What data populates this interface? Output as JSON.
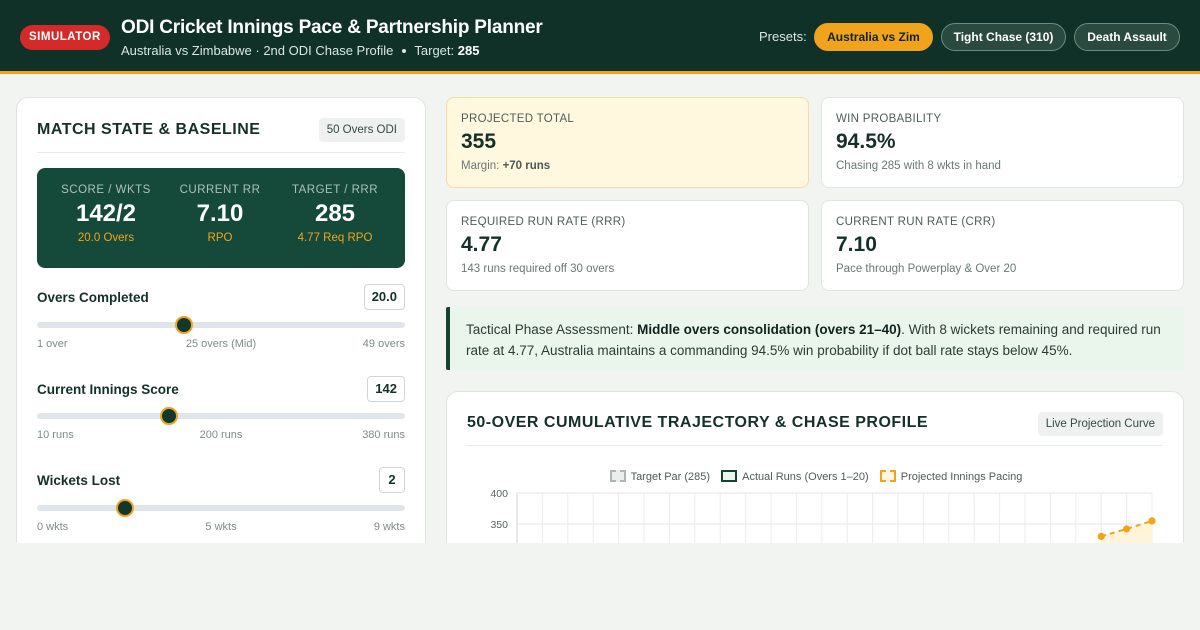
{
  "header": {
    "badge": "SIMULATOR",
    "title": "ODI Cricket Innings Pace & Partnership Planner",
    "subtitle": "Australia vs Zimbabwe · 2nd ODI Chase Profile",
    "target_label": "Target:",
    "target_value": "285",
    "presets_label": "Presets:",
    "presets": [
      "Australia vs Zim",
      "Tight Chase (310)",
      "Death Assault"
    ],
    "accent": "#f0a31b",
    "brand": "#0f3128"
  },
  "left": {
    "title": "MATCH STATE & BASELINE",
    "tag": "50 Overs ODI",
    "scoreboard": [
      {
        "label": "SCORE / WKTS",
        "value": "142/2",
        "foot": "20.0 Overs"
      },
      {
        "label": "CURRENT RR",
        "value": "7.10",
        "foot": "RPO"
      },
      {
        "label": "TARGET / RRR",
        "value": "285",
        "foot": "4.77 Req RPO"
      }
    ],
    "sliders": {
      "overs": {
        "label": "Overs Completed",
        "value": "20.0",
        "fraction": 0.4,
        "ticks": [
          "1 over",
          "25 overs (Mid)",
          "49 overs"
        ]
      },
      "score": {
        "label": "Current Innings Score",
        "value": "142",
        "fraction": 0.36,
        "ticks": [
          "10 runs",
          "200 runs",
          "380 runs"
        ]
      },
      "wickets": {
        "label": "Wickets Lost",
        "value": "2",
        "fraction": 0.24,
        "ticks": [
          "0 wkts",
          "5 wkts",
          "9 wkts"
        ]
      }
    }
  },
  "metrics": {
    "projected": {
      "label": "PROJECTED TOTAL",
      "value": "355",
      "sub_label": "Margin:",
      "sub_value": "+70 runs"
    },
    "win": {
      "label": "WIN PROBABILITY",
      "value": "94.5%",
      "sub": "Chasing 285 with 8 wkts in hand"
    },
    "rrr": {
      "label": "REQUIRED RUN RATE (RRR)",
      "value": "4.77",
      "sub": "143 runs required off 30 overs"
    },
    "crr": {
      "label": "CURRENT RUN RATE (CRR)",
      "value": "7.10",
      "sub": "Pace through Powerplay & Over 20"
    }
  },
  "assessment": {
    "prefix": "Tactical Phase Assessment: ",
    "phase": "Middle overs consolidation (overs 21–40)",
    "body": ". With 8 wickets remaining and required run rate at 4.77, Australia maintains a commanding 94.5% win probability if dot ball rate stays below 45%."
  },
  "chart": {
    "title": "50-OVER CUMULATIVE TRAJECTORY & CHASE PROFILE",
    "tag": "Live Projection Curve"
  },
  "chart_data": {
    "type": "line",
    "legend": [
      "Target Par (285)",
      "Actual Runs (Overs 1–20)",
      "Projected Innings Pacing"
    ],
    "y_ticks": [
      "400",
      "350"
    ],
    "ylim_visible": [
      350,
      400
    ],
    "series": [
      {
        "name": "Projected Innings Pacing",
        "x": [
          48,
          49,
          50
        ],
        "values": [
          330,
          342,
          355
        ],
        "color": "#f0a31b"
      }
    ]
  }
}
